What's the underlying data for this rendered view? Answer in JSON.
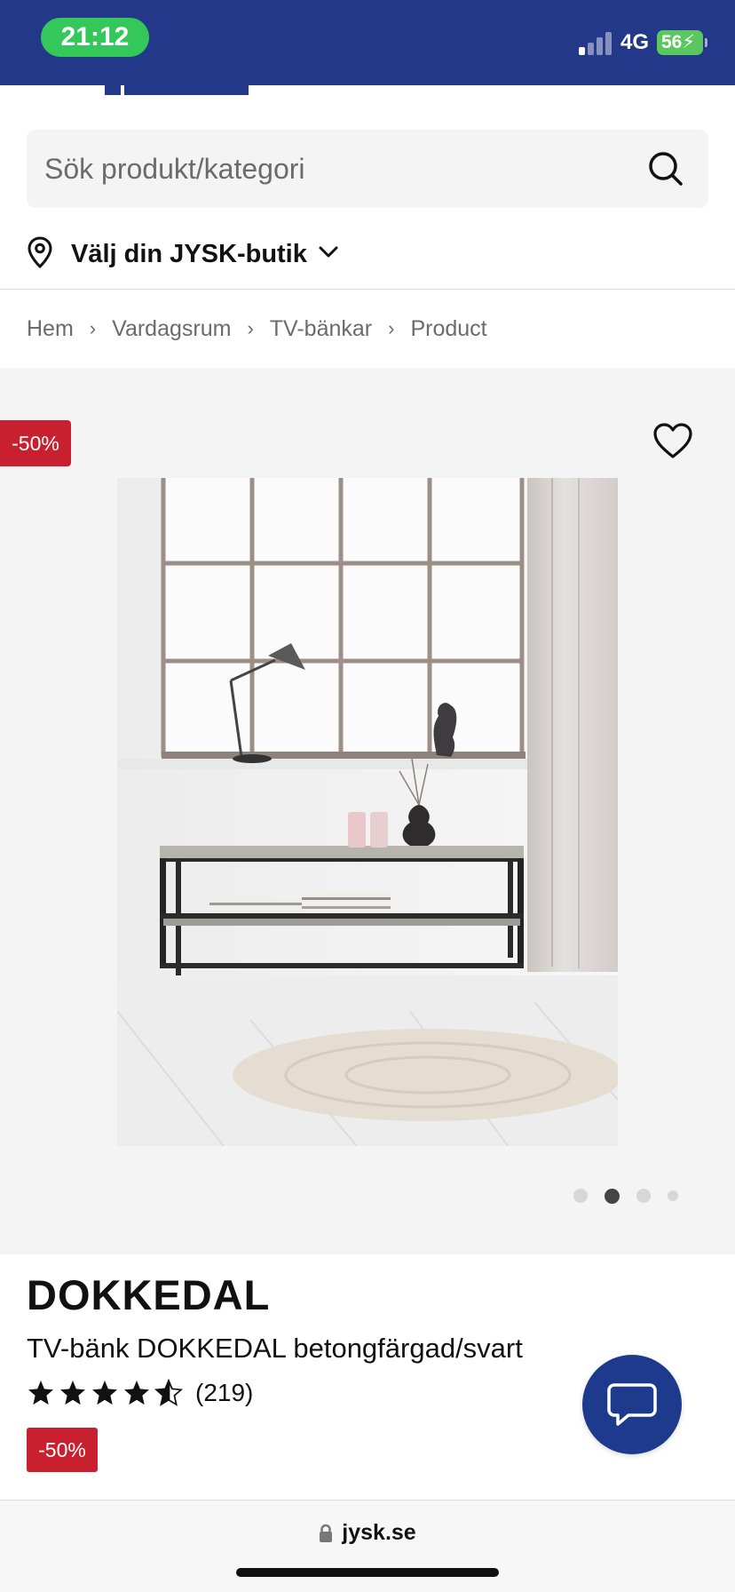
{
  "status_bar": {
    "time": "21:12",
    "network": "4G",
    "battery": "56"
  },
  "search": {
    "placeholder": "Sök produkt/kategori",
    "icon": "search-icon"
  },
  "store_selector": {
    "label": "Välj din JYSK-butik",
    "icon": "location-pin-icon"
  },
  "breadcrumb": [
    "Hem",
    "Vardagsrum",
    "TV-bänkar",
    "Product"
  ],
  "gallery": {
    "discount_badge": "-50%",
    "wishlist_icon": "heart-icon",
    "image_count": 4,
    "active_index": 1
  },
  "product": {
    "brand": "DOKKEDAL",
    "name": "TV-bänk DOKKEDAL betongfärgad/svart",
    "rating": 4.5,
    "review_count": "(219)",
    "discount_badge": "-50%"
  },
  "chat": {
    "icon": "chat-bubble-icon"
  },
  "browser": {
    "url": "jysk.se",
    "lock_icon": "lock-icon"
  },
  "colors": {
    "brand_blue": "#24388a",
    "sale_red": "#c8202f",
    "chat_blue": "#1d3a8c",
    "status_green": "#34c759"
  }
}
